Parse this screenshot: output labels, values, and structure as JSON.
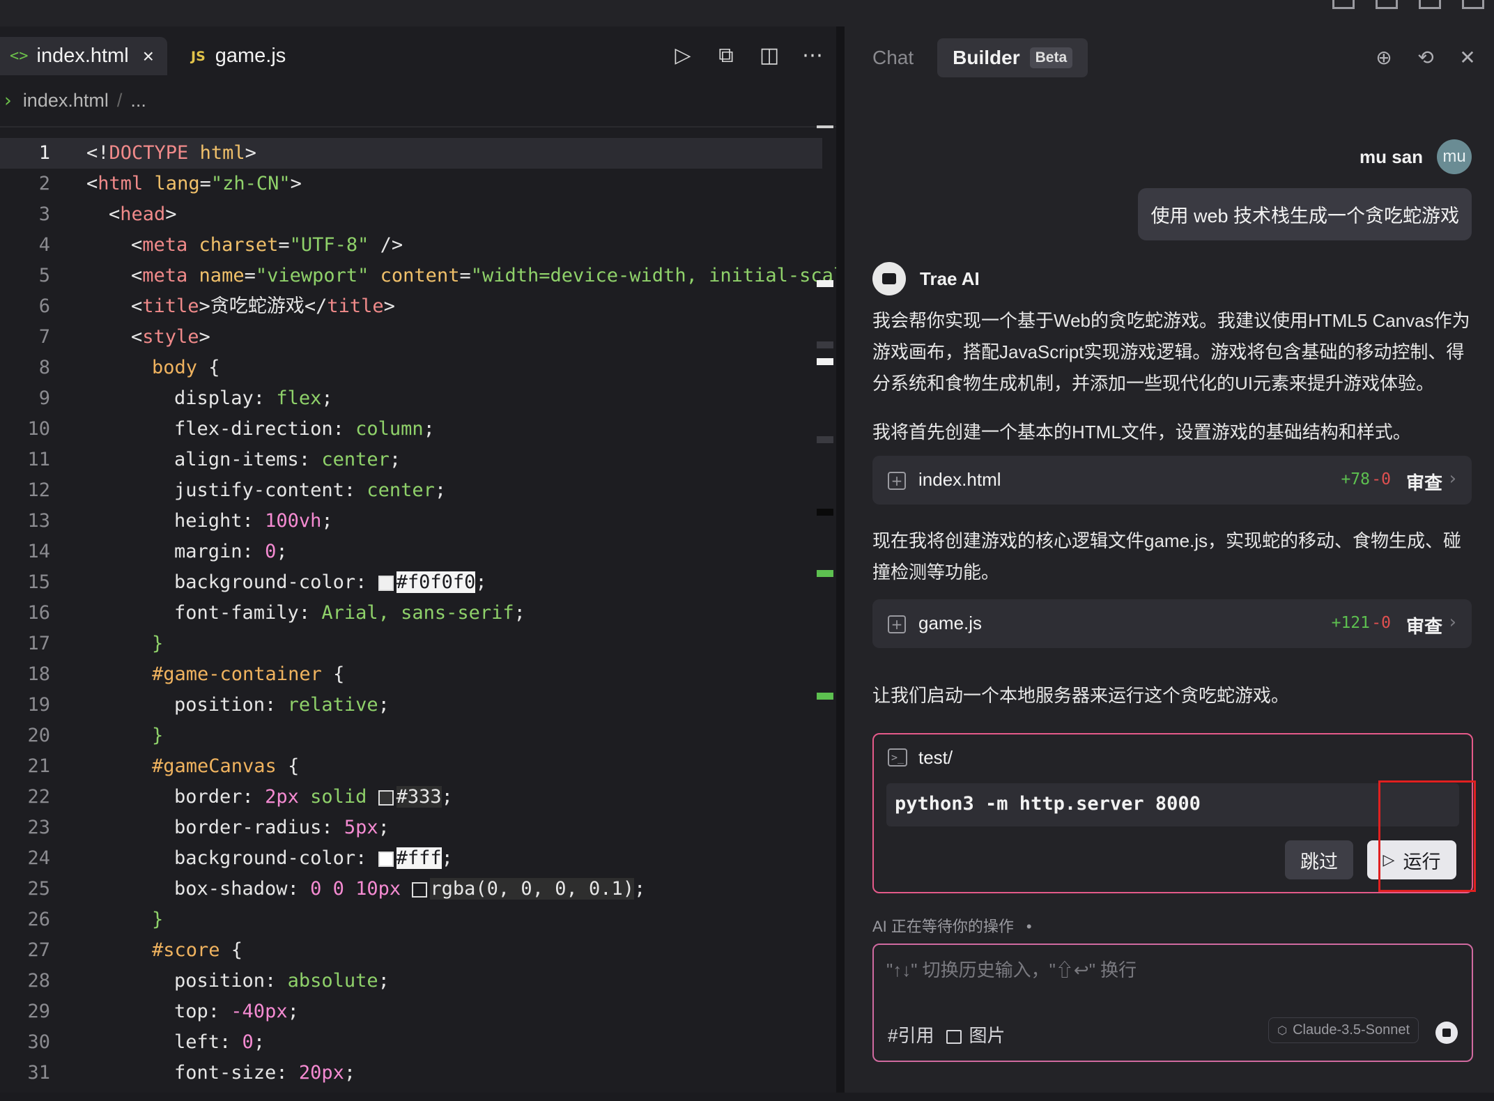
{
  "editor": {
    "tabs": [
      {
        "label": "index.html",
        "icon": "code-icon",
        "active": true
      },
      {
        "label": "game.js",
        "icon": "js-icon",
        "active": false
      }
    ],
    "tab_close": "×",
    "tab_code_glyph": "<>",
    "tab_js_glyph": "JS",
    "breadcrumb": {
      "file": "index.html",
      "rest": "..."
    },
    "lines": [
      {
        "n": "1"
      },
      {
        "n": "2"
      },
      {
        "n": "3"
      },
      {
        "n": "4"
      },
      {
        "n": "5"
      },
      {
        "n": "6"
      },
      {
        "n": "7"
      },
      {
        "n": "8"
      },
      {
        "n": "9"
      },
      {
        "n": "10"
      },
      {
        "n": "11"
      },
      {
        "n": "12"
      },
      {
        "n": "13"
      },
      {
        "n": "14"
      },
      {
        "n": "15"
      },
      {
        "n": "16"
      },
      {
        "n": "17"
      },
      {
        "n": "18"
      },
      {
        "n": "19"
      },
      {
        "n": "20"
      },
      {
        "n": "21"
      },
      {
        "n": "22"
      },
      {
        "n": "23"
      },
      {
        "n": "24"
      },
      {
        "n": "25"
      },
      {
        "n": "26"
      },
      {
        "n": "27"
      },
      {
        "n": "28"
      },
      {
        "n": "29"
      },
      {
        "n": "30"
      },
      {
        "n": "31"
      }
    ],
    "code": {
      "l1a": "<!",
      "l1b": "DOCTYPE",
      "l1c": " html",
      "l1d": ">",
      "l2a": "<",
      "l2b": "html",
      "l2c": " lang",
      "l2d": "=",
      "l2e": "\"zh-CN\"",
      "l2f": ">",
      "l3a": "<",
      "l3b": "head",
      "l3c": ">",
      "l4a": "<",
      "l4b": "meta",
      "l4c": " charset",
      "l4d": "=",
      "l4e": "\"UTF-8\"",
      "l4f": " />",
      "l5a": "<",
      "l5b": "meta",
      "l5c": " name",
      "l5d": "=",
      "l5e": "\"viewport\"",
      "l5f": " content",
      "l5g": "=",
      "l5h": "\"width=device-width, initial-scale=",
      "l6a": "<",
      "l6b": "title",
      "l6c": ">",
      "l6d": "贪吃蛇游戏",
      "l6e": "</",
      "l6f": "title",
      "l6g": ">",
      "l7a": "<",
      "l7b": "style",
      "l7c": ">",
      "l8a": "body",
      "l8b": " {",
      "l9a": "display",
      "l9b": ": ",
      "l9c": "flex",
      "l9d": ";",
      "l10a": "flex-direction",
      "l10b": ": ",
      "l10c": "column",
      "l10d": ";",
      "l11a": "align-items",
      "l11b": ": ",
      "l11c": "center",
      "l11d": ";",
      "l12a": "justify-content",
      "l12b": ": ",
      "l12c": "center",
      "l12d": ";",
      "l13a": "height",
      "l13b": ": ",
      "l13c": "100vh",
      "l13d": ";",
      "l14a": "margin",
      "l14b": ": ",
      "l14c": "0",
      "l14d": ";",
      "l15a": "background-color",
      "l15b": ": ",
      "l15c": "#f0f0f0",
      "l15d": ";",
      "l16a": "font-family",
      "l16b": ": ",
      "l16c": "Arial, sans-serif",
      "l16d": ";",
      "l17a": "}",
      "l18a": "#game-container",
      "l18b": " {",
      "l19a": "position",
      "l19b": ": ",
      "l19c": "relative",
      "l19d": ";",
      "l20a": "}",
      "l21a": "#gameCanvas",
      "l21b": " {",
      "l22a": "border",
      "l22b": ": ",
      "l22c": "2px",
      "l22d": " solid ",
      "l22e": "#333",
      "l22f": ";",
      "l23a": "border-radius",
      "l23b": ": ",
      "l23c": "5px",
      "l23d": ";",
      "l24a": "background-color",
      "l24b": ": ",
      "l24c": "#fff",
      "l24d": ";",
      "l25a": "box-shadow",
      "l25b": ": ",
      "l25c": "0 0 10px",
      "l25d": "rgba(0, 0, 0, 0.1)",
      "l25e": ";",
      "l26a": "}",
      "l27a": "#score",
      "l27b": " {",
      "l28a": "position",
      "l28b": ": ",
      "l28c": "absolute",
      "l28d": ";",
      "l29a": "top",
      "l29b": ": ",
      "l29c": "-40px",
      "l29d": ";",
      "l30a": "left",
      "l30b": ": ",
      "l30c": "0",
      "l30d": ";",
      "l31a": "font-size",
      "l31b": ": ",
      "l31c": "20px",
      "l31d": ";"
    }
  },
  "chat": {
    "tabs": {
      "chat": "Chat",
      "builder": "Builder",
      "beta": "Beta"
    },
    "user": {
      "name": "mu san",
      "avatar": "mu",
      "message": "使用 web 技术栈生成一个贪吃蛇游戏"
    },
    "ai": {
      "name": "Trae AI"
    },
    "para1": "我会帮你实现一个基于Web的贪吃蛇游戏。我建议使用HTML5 Canvas作为游戏画布，搭配JavaScript实现游戏逻辑。游戏将包含基础的移动控制、得分系统和食物生成机制，并添加一些现代化的UI元素来提升游戏体验。",
    "para2": "我将首先创建一个基本的HTML文件，设置游戏的基础结构和样式。",
    "file1": {
      "name": "index.html",
      "add": "+78",
      "del": "-0",
      "review": "审查"
    },
    "para3": "现在我将创建游戏的核心逻辑文件game.js，实现蛇的移动、食物生成、碰撞检测等功能。",
    "file2": {
      "name": "game.js",
      "add": "+121",
      "del": "-0",
      "review": "审查"
    },
    "para4": "让我们启动一个本地服务器来运行这个贪吃蛇游戏。",
    "command": {
      "cwd": "test/",
      "text": "python3 -m http.server 8000",
      "skip": "跳过",
      "run": "运行"
    },
    "waiting": "AI 正在等待你的操作",
    "waiting_dot": "•",
    "input": {
      "placeholder": "\"↑↓\" 切换历史输入，\"⇧↩\" 换行",
      "ref": "#引用",
      "image": "图片",
      "model": "Claude-3.5-Sonnet"
    }
  }
}
